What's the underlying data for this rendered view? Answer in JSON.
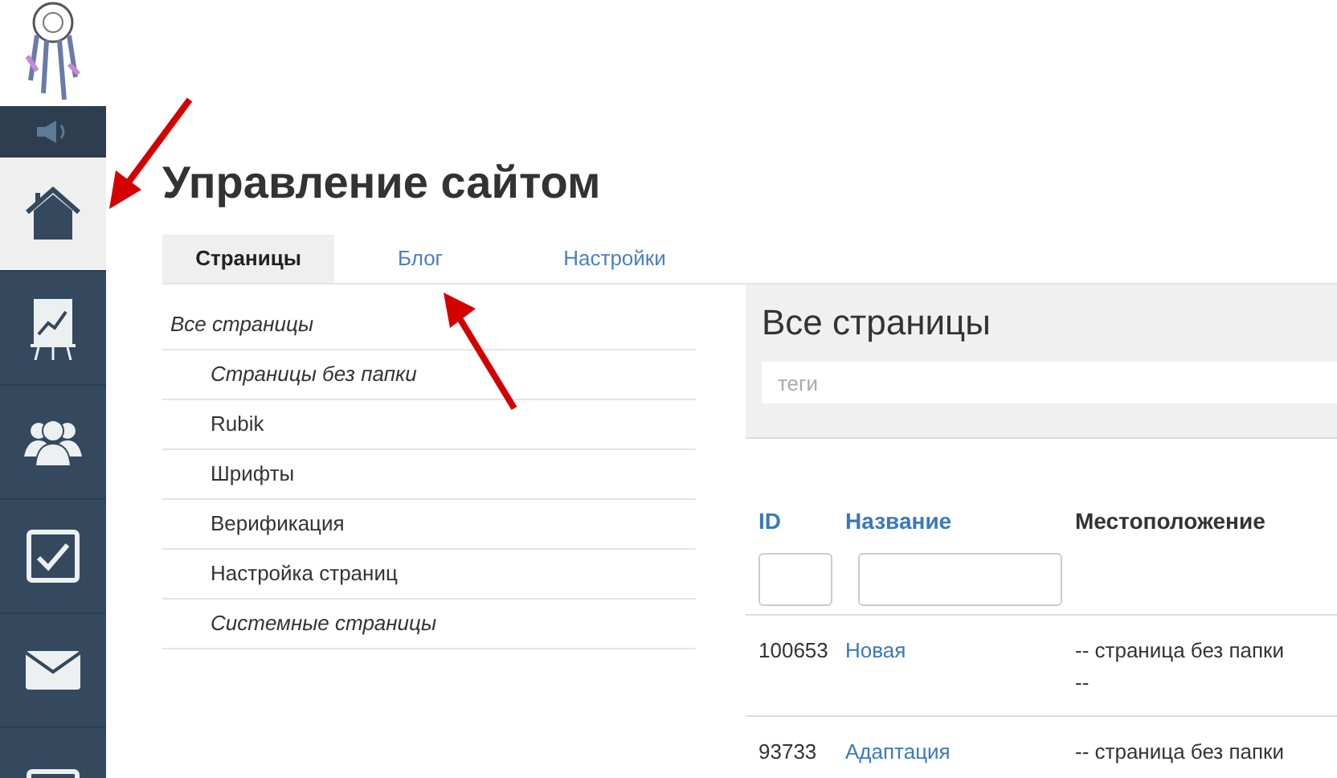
{
  "sidebar": {
    "items": [
      {
        "kind": "sound",
        "selected": false
      },
      {
        "kind": "home",
        "selected": true
      },
      {
        "kind": "chart",
        "selected": false
      },
      {
        "kind": "users",
        "selected": false
      },
      {
        "kind": "tasks",
        "selected": false
      },
      {
        "kind": "mail",
        "selected": false
      },
      {
        "kind": "screen",
        "selected": false
      }
    ]
  },
  "title": "Управление сайтом",
  "tabs": [
    {
      "label": "Страницы",
      "selected": true
    },
    {
      "label": "Блог",
      "selected": false
    },
    {
      "label": "Настройки",
      "selected": false
    }
  ],
  "folders": [
    {
      "label": "Все страницы",
      "kind": "virtual",
      "children": [
        {
          "label": "Страницы без папки",
          "kind": "virtual"
        },
        {
          "label": "Rubik",
          "kind": "folder"
        },
        {
          "label": "Шрифты",
          "kind": "folder"
        },
        {
          "label": "Верификация",
          "kind": "folder"
        },
        {
          "label": "Настройка страниц",
          "kind": "folder"
        },
        {
          "label": "Системные страницы",
          "kind": "virtual"
        }
      ]
    }
  ],
  "panel": {
    "title": "Все страницы",
    "tags": {
      "placeholder": "теги"
    }
  },
  "table": {
    "columns": [
      {
        "label": "ID",
        "sortable": true
      },
      {
        "label": "Название",
        "sortable": true
      },
      {
        "label": "Местоположение",
        "sortable": false
      }
    ],
    "rows": [
      {
        "id": "100653",
        "name": "Новая",
        "location": [
          "-- страница без папки",
          "--"
        ]
      },
      {
        "id": "93733",
        "name": "Адаптация",
        "location": [
          "-- страница без папки"
        ]
      }
    ]
  }
}
